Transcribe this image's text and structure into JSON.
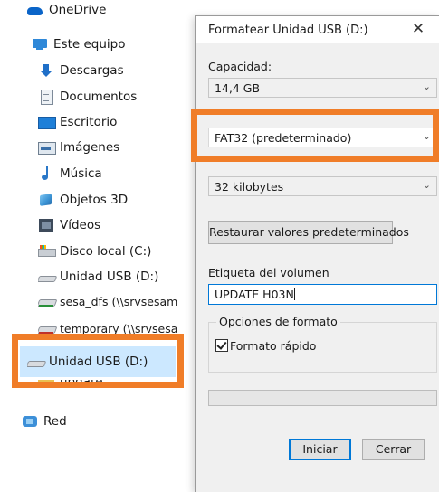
{
  "explorer": {
    "items": [
      {
        "label": "OneDrive"
      },
      {
        "label": "Este equipo"
      },
      {
        "label": "Descargas"
      },
      {
        "label": "Documentos"
      },
      {
        "label": "Escritorio"
      },
      {
        "label": "Imágenes"
      },
      {
        "label": "Música"
      },
      {
        "label": "Objetos 3D"
      },
      {
        "label": "Vídeos"
      },
      {
        "label": "Disco local (C:)"
      },
      {
        "label": "Unidad USB (D:)"
      },
      {
        "label": "sesa_dfs (\\\\srvsesam"
      },
      {
        "label": "temporary (\\\\srvsesa"
      },
      {
        "label": "Unidad USB (D:)"
      },
      {
        "label": "update"
      },
      {
        "label": "Red"
      }
    ],
    "selected_item": "Unidad USB (D:)"
  },
  "dialog": {
    "title": "Formatear Unidad USB (D:)",
    "close_symbol": "✕",
    "capacity": {
      "label": "Capacidad:",
      "value": "14,4 GB"
    },
    "file_system": {
      "value": "FAT32 (predeterminado)"
    },
    "allocation": {
      "value": "32 kilobytes"
    },
    "restore_button": "Restaurar valores predeterminados",
    "volume_label": {
      "label": "Etiqueta del volumen",
      "value": "UPDATE H03N"
    },
    "format_options": {
      "label": "Opciones de formato",
      "quick_format": "Formato rápido",
      "quick_format_checked": true
    },
    "buttons": {
      "start": "Iniciar",
      "close": "Cerrar"
    }
  },
  "colors": {
    "highlight": "#f07d28",
    "selection": "#cce8ff",
    "focus": "#0078d7"
  }
}
